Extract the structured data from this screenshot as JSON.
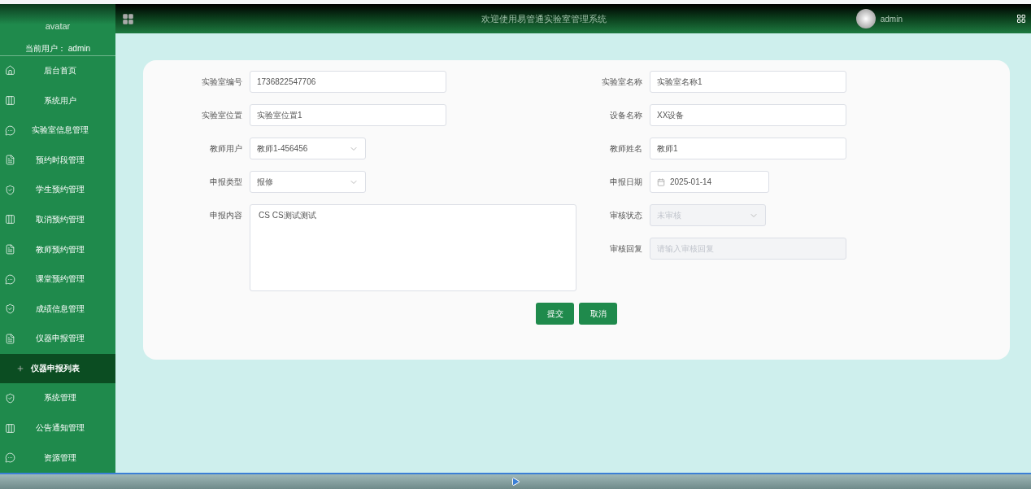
{
  "sidebar": {
    "avatar_label": "avatar",
    "current_user_label": "当前用户：",
    "current_user": "admin",
    "items": [
      {
        "label": "后台首页",
        "kind": "home",
        "selected": false
      },
      {
        "label": "系统用户",
        "kind": "columns",
        "selected": false
      },
      {
        "label": "实验室信息管理",
        "kind": "chat",
        "selected": false
      },
      {
        "label": "预约时段管理",
        "kind": "doc",
        "selected": false
      },
      {
        "label": "学生预约管理",
        "kind": "shield",
        "selected": false
      },
      {
        "label": "取消预约管理",
        "kind": "columns",
        "selected": false
      },
      {
        "label": "教师预约管理",
        "kind": "doc",
        "selected": false
      },
      {
        "label": "课堂预约管理",
        "kind": "chat",
        "selected": false
      },
      {
        "label": "成绩信息管理",
        "kind": "shield",
        "selected": false
      },
      {
        "label": "仪器申报管理",
        "kind": "doc",
        "selected": false,
        "children": [
          {
            "label": "仪器申报列表",
            "selected": true
          }
        ]
      },
      {
        "label": "系统管理",
        "kind": "shield",
        "selected": false
      },
      {
        "label": "公告通知管理",
        "kind": "columns",
        "selected": false
      },
      {
        "label": "资源管理",
        "kind": "chat",
        "selected": false
      }
    ]
  },
  "header": {
    "title": "欢迎使用易管通实验室管理系统",
    "user": "admin"
  },
  "form": {
    "left": [
      {
        "kind": "text",
        "label": "实验室编号",
        "value": "1736822547706",
        "disabled": false
      },
      {
        "kind": "text",
        "label": "实验室位置",
        "value": "实验室位置1",
        "disabled": false
      },
      {
        "kind": "select",
        "label": "教师用户",
        "value": "教师1-456456",
        "disabled": false
      },
      {
        "kind": "select",
        "label": "申报类型",
        "value": "报修",
        "disabled": false
      },
      {
        "kind": "textarea",
        "label": "申报内容",
        "value": "CS CS测试测试",
        "disabled": false
      }
    ],
    "right": [
      {
        "kind": "text",
        "label": "实验室名称",
        "value": "实验室名称1",
        "disabled": false
      },
      {
        "kind": "text",
        "label": "设备名称",
        "value": "XX设备",
        "disabled": false
      },
      {
        "kind": "text",
        "label": "教师姓名",
        "value": "教师1",
        "disabled": false
      },
      {
        "kind": "date",
        "label": "申报日期",
        "value": "2025-01-14",
        "disabled": false
      },
      {
        "kind": "select",
        "label": "审核状态",
        "value": "未审核",
        "disabled": true
      },
      {
        "kind": "text",
        "label": "审核回复",
        "placeholder": "请输入审核回复",
        "disabled": true
      }
    ],
    "buttons": [
      "提交",
      "取消"
    ]
  }
}
